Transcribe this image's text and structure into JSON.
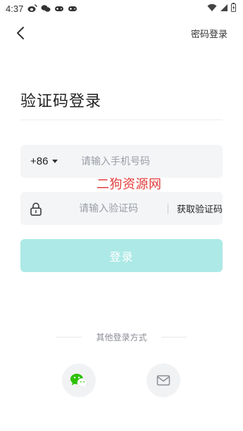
{
  "status_bar": {
    "time": "4:37",
    "left_icons": [
      "weibo-icon",
      "wechat-small-icon",
      "gamepad-icon",
      "gamepad-icon"
    ],
    "right_icons": [
      "wifi-icon",
      "signal-icon",
      "battery-icon"
    ]
  },
  "header": {
    "back_icon": "chevron-left-icon",
    "password_login_label": "密码登录"
  },
  "title": "验证码登录",
  "phone": {
    "country_code": "+86",
    "placeholder": "请输入手机号码",
    "value": ""
  },
  "code": {
    "placeholder": "请输入验证码",
    "value": "",
    "get_code_label": "获取验证码",
    "lock_icon": "lock-icon"
  },
  "watermark": "二狗资源网",
  "login_button_label": "登录",
  "other_methods_label": "其他登录方式",
  "social": {
    "wechat_icon": "wechat-icon",
    "email_icon": "mail-icon"
  },
  "colors": {
    "login_button": "#ade9e6",
    "field_bg": "#f4f5f7",
    "watermark": "#e23b3b",
    "wechat_green": "#2dc100"
  }
}
